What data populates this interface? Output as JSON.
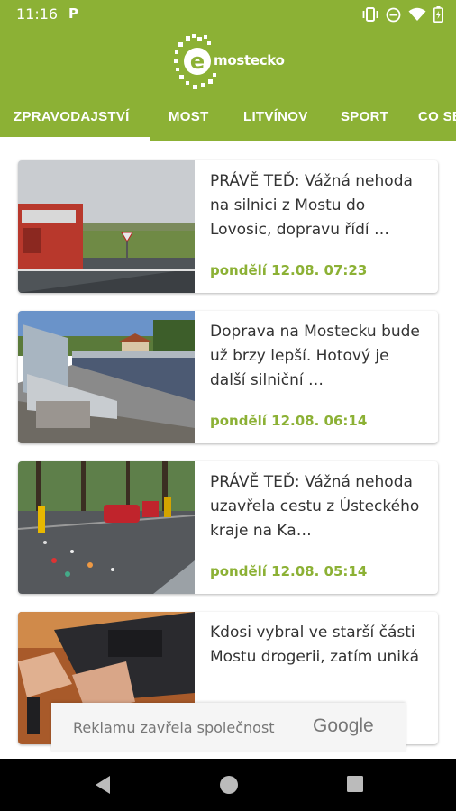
{
  "status": {
    "time": "11:16",
    "p_label": "P"
  },
  "app": {
    "logo_text": "mostecko",
    "brand_color": "#8cb135"
  },
  "tabs": [
    {
      "label": "ZPRAVODAJSTVÍ",
      "active": true
    },
    {
      "label": "MOST",
      "active": false
    },
    {
      "label": "LITVÍNOV",
      "active": false
    },
    {
      "label": "SPORT",
      "active": false
    },
    {
      "label": "CO SE",
      "active": false
    }
  ],
  "articles": [
    {
      "title": "PRÁVĚ TEĎ: Vážná nehoda na silnici z Mostu do Lovosic, dopravu řídí …",
      "date": "pondělí 12.08. 07:23"
    },
    {
      "title": "Doprava na Mostecku bude už brzy lepší. Hotový je další silniční …",
      "date": "pondělí 12.08. 06:14"
    },
    {
      "title": "PRÁVĚ TEĎ: Vážná nehoda uzavřela cestu z Ústeckého kraje na Ka…",
      "date": "pondělí 12.08. 05:14"
    },
    {
      "title": "Kdosi vybral ve starší části Mostu drogerii, zatím uniká",
      "date": ""
    }
  ],
  "ad": {
    "text": "Reklamu zavřela společnost",
    "brand": "Google"
  },
  "icons": {
    "vibrate": "vibrate-icon",
    "dnd": "do-not-disturb-icon",
    "wifi": "wifi-icon",
    "battery": "battery-icon",
    "back": "back-icon",
    "home": "home-icon",
    "recents": "recents-icon"
  }
}
